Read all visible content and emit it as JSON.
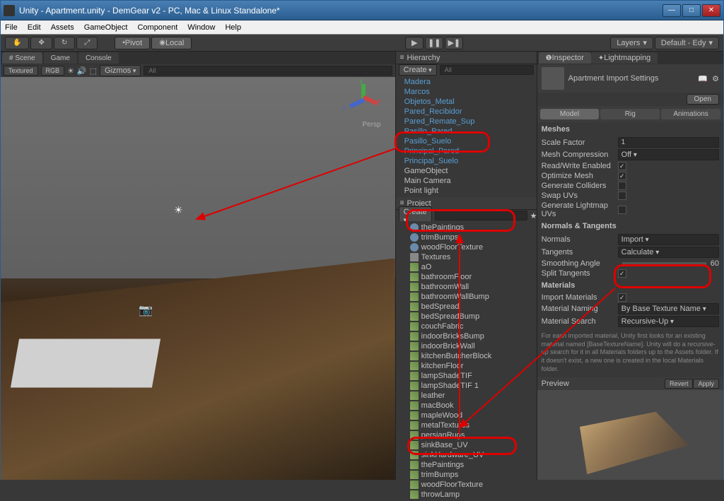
{
  "window": {
    "title": "Unity - Apartment.unity - DemGear v2 - PC, Mac & Linux Standalone*"
  },
  "menu": {
    "file": "File",
    "edit": "Edit",
    "assets": "Assets",
    "gameobject": "GameObject",
    "component": "Component",
    "window": "Window",
    "help": "Help"
  },
  "toolbar": {
    "pivot": "Pivot",
    "local": "Local",
    "layers": "Layers",
    "default": "Default - Edy"
  },
  "tabs": {
    "scene": "# Scene",
    "game": "Game",
    "console": "Console",
    "textured": "Textured",
    "rgb": "RGB",
    "gizmos": "Gizmos"
  },
  "viewport": {
    "persp": "Persp"
  },
  "hierarchy": {
    "title": "Hierarchy",
    "create": "Create",
    "all": "All",
    "items": [
      "Madera",
      "Marcos",
      "Objetos_Metal",
      "Pared_Recibidor",
      "Pared_Remate_Sup",
      "Pasillo_Pared",
      "Pasillo_Suelo",
      "Principal_Pared",
      "Principal_Suelo",
      "GameObject",
      "Main Camera",
      "Point light"
    ]
  },
  "project": {
    "title": "Project",
    "create": "Create",
    "mats": [
      "thePaintings",
      "trimBumps",
      "woodFloorTexture"
    ],
    "texfolder": "Textures",
    "textures": [
      "aO",
      "bathroomFloor",
      "bathroomWall",
      "bathroomWallBump",
      "bedSpread",
      "bedSpreadBump",
      "couchFabric",
      "indoorBricksBump",
      "indoorBrickWall",
      "kitchenButcherBlock",
      "kitchenFloor",
      "lampShadeTIF",
      "lampShadeTIF 1",
      "leather",
      "macBook",
      "mapleWood",
      "metalTextures",
      "persianRugs",
      "sinkBase_UV",
      "sinkHardware_UV",
      "thePaintings",
      "trimBumps",
      "woodFloorTexture",
      "throwLamp"
    ]
  },
  "inspector": {
    "tab1": "Inspector",
    "tab2": "Lightmapping",
    "title": "Apartment Import Settings",
    "open": "Open",
    "tabs": {
      "model": "Model",
      "rig": "Rig",
      "anim": "Animations"
    },
    "sec_meshes": "Meshes",
    "scale_factor": {
      "l": "Scale Factor",
      "v": "1"
    },
    "mesh_comp": {
      "l": "Mesh Compression",
      "v": "Off"
    },
    "rw": {
      "l": "Read/Write Enabled"
    },
    "opt": {
      "l": "Optimize Mesh"
    },
    "gen": {
      "l": "Generate Colliders"
    },
    "swap": {
      "l": "Swap UVs"
    },
    "glm": {
      "l": "Generate Lightmap UVs"
    },
    "sec_normals": "Normals & Tangents",
    "normals": {
      "l": "Normals",
      "v": "Import"
    },
    "tangents": {
      "l": "Tangents",
      "v": "Calculate"
    },
    "smooth": {
      "l": "Smoothing Angle",
      "v": "60"
    },
    "split": {
      "l": "Split Tangents"
    },
    "sec_materials": "Materials",
    "imp_mat": {
      "l": "Import Materials"
    },
    "mat_naming": {
      "l": "Material Naming",
      "v": "By Base Texture Name"
    },
    "mat_search": {
      "l": "Material Search",
      "v": "Recursive-Up"
    },
    "help": "For each imported material, Unity first looks for an existing material named [BaseTextureName]. Unity will do a recursive-up search for it in all Materials folders up to the Assets folder. If it doesn't exist, a new one is created in the local Materials folder.",
    "preview": "Preview",
    "revert": "Revert",
    "apply": "Apply"
  }
}
